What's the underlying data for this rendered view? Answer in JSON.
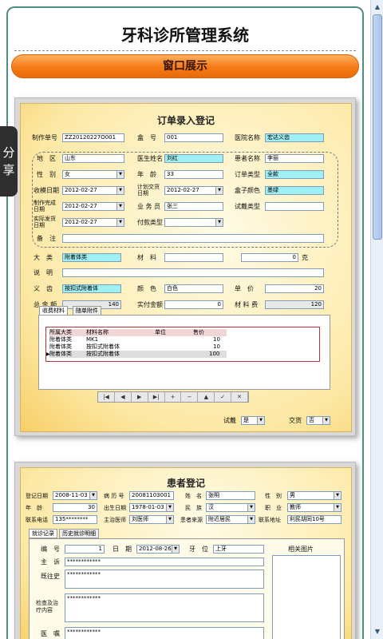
{
  "app_title": "牙科诊所管理系统",
  "banner_label": "窗口展示",
  "share_tab": [
    "分",
    "享"
  ],
  "order_form": {
    "title": "订单录入登记",
    "fields": {
      "order_no_label": "制作单号",
      "order_no": "ZZ20120227O001",
      "box_no_label": "盒　号",
      "box_no": "001",
      "hospital_label": "医院名称",
      "hospital": "宏达义齿",
      "region_label": "地　区",
      "region": "山东",
      "doctor_label": "医生姓名",
      "doctor": "刘红",
      "patient_label": "患者名称",
      "patient": "李丽",
      "gender_label": "性　别",
      "gender": "女",
      "age_label": "年　龄",
      "age": "33",
      "order_type_label": "订单类型",
      "order_type": "全款",
      "receive_date_label": "收模日期",
      "receive_date": "2012-02-27",
      "plan_date_label": "计划交货日期",
      "plan_date": "2012-02-27",
      "box_color_label": "盒子颜色",
      "box_color": "墨绿",
      "made_date_label": "制作完成日期",
      "made_date": "2012-02-27",
      "salesman_label": "业 务 员",
      "salesman": "张三",
      "trial_type_label": "试戴类型",
      "trial_type": "",
      "ship_date_label": "实际发货日期",
      "ship_date": "2012-02-27",
      "pay_type_label": "付款类型",
      "pay_type": "",
      "remark_label": "备　注",
      "remark": "",
      "category_label": "大　类",
      "category": "附着体类",
      "material_label": "材　料",
      "material": "",
      "material_grams": "0",
      "grams_unit": "克",
      "desc_label": "说　明",
      "desc": "",
      "denture_label": "义　齿",
      "denture": "按扣式附着体",
      "color_label": "颜　色",
      "color": "白色",
      "price_label": "单　价",
      "price": "20",
      "total_label": "总 金 额",
      "total": "140",
      "paid_label": "实付金额",
      "paid": "0",
      "material_fee_label": "材 料 费",
      "material_fee": "120"
    },
    "tabs": [
      "收费材料",
      "随单附件"
    ],
    "grid": {
      "headers": [
        "所属大类",
        "材料名称",
        "单位",
        "售价"
      ],
      "rows": [
        [
          "附着体类",
          "MK1",
          "",
          "10"
        ],
        [
          "附着体类",
          "按扣式附着体",
          "",
          "10"
        ],
        [
          "附着体类",
          "按扣式附着体",
          "",
          "100"
        ]
      ]
    },
    "nav": [
      "|◀",
      "◀",
      "▶",
      "▶|",
      "+",
      "−",
      "▲",
      "✓",
      "✕"
    ],
    "trial_label": "试戴",
    "trial_value": "是",
    "delivery_label": "交货",
    "delivery_value": "否"
  },
  "patient_form": {
    "title": "患者登记",
    "reg_date_label": "登记日期",
    "reg_date": "2008-11-03",
    "record_label": "病 历 号",
    "record": "20081103001",
    "name_label": "姓　名",
    "name": "张明",
    "sex_label": "性　别",
    "sex": "男",
    "age_label": "年　龄",
    "age": "30",
    "birth_label": "出生日期",
    "birth": "1978-01-03",
    "nation_label": "民　族",
    "nation": "汉",
    "job_label": "职　业",
    "job": "教师",
    "phone_label": "联系电话",
    "phone": "135********",
    "doctor_label": "主治医师",
    "doctor": "刘医师",
    "source_label": "患者来源",
    "source": "附近居民",
    "address_label": "联系地址",
    "address": "利民胡同10号",
    "tabs": [
      "就诊记录",
      "历史就诊明细"
    ],
    "visit_no_label": "编　号",
    "visit_no": "1",
    "visit_date_label": "日　期",
    "visit_date": "2012-08-26",
    "tooth_label": "牙　位",
    "tooth": "上牙",
    "photo_label": "相关图片",
    "complaint_label": "主　诉",
    "complaint": "************",
    "history_label": "既往史",
    "history": "************",
    "exam_label": "检查及治疗内容",
    "exam": "************",
    "advice_label": "医　嘱",
    "advice": "************"
  }
}
